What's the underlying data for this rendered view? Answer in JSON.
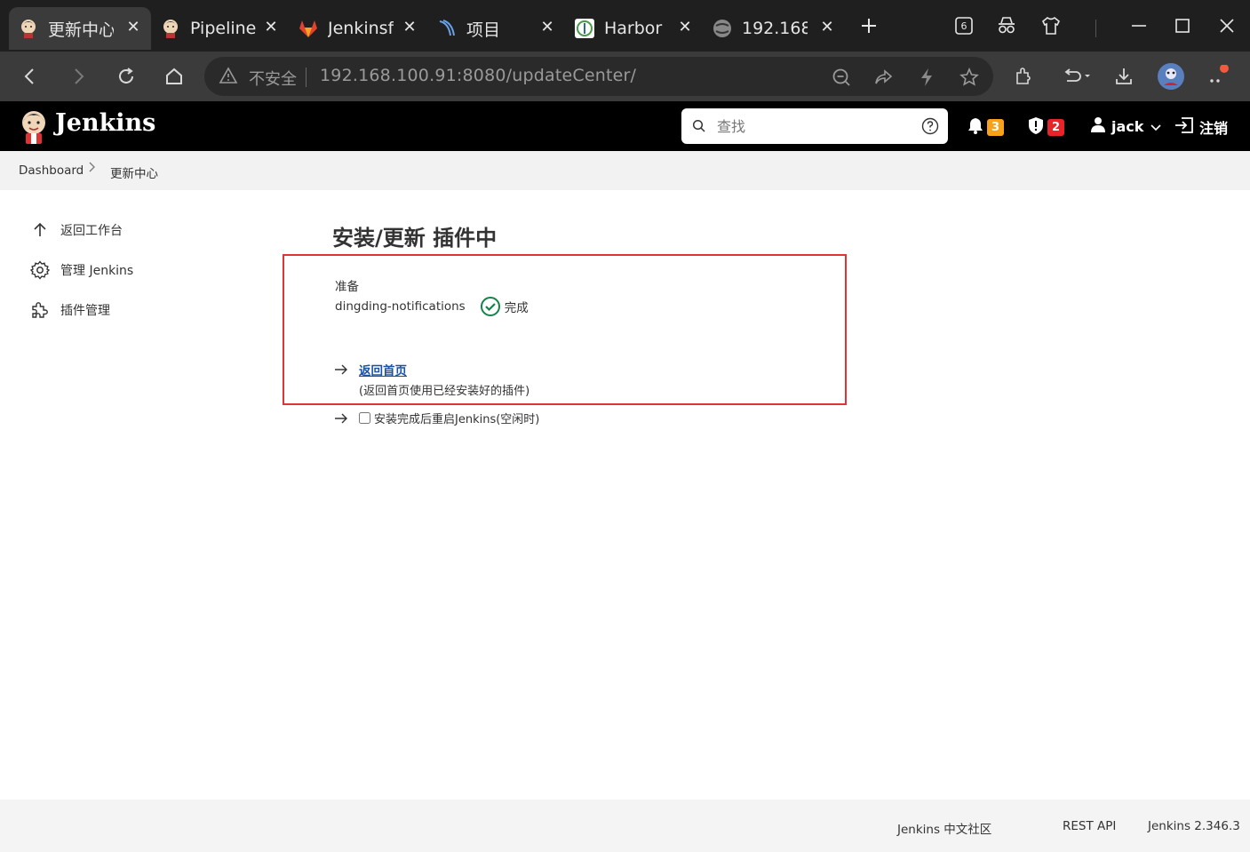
{
  "browser": {
    "tabs": [
      {
        "title": "更新中心",
        "icon": "jenkins-favicon-icon",
        "active": true
      },
      {
        "title": "Pipeline",
        "icon": "jenkins-favicon-icon",
        "active": false
      },
      {
        "title": "Jenkinsf",
        "icon": "gitlab-favicon-icon",
        "active": false
      },
      {
        "title": "项目",
        "icon": "project-favicon-icon",
        "active": false
      },
      {
        "title": "Harbor",
        "icon": "harbor-favicon-icon",
        "active": false
      },
      {
        "title": "192.168",
        "icon": "globe-favicon-icon",
        "active": false
      }
    ],
    "tab_count_badge": "6",
    "address": {
      "security_label": "不安全",
      "url": "192.168.100.91:8080/updateCenter/"
    }
  },
  "jenkins": {
    "brand": "Jenkins",
    "search_placeholder": "查找",
    "notifications_count": "3",
    "security_count": "2",
    "user": "jack",
    "logout": "注销",
    "breadcrumb": [
      "Dashboard",
      "更新中心"
    ],
    "sidebar": [
      {
        "label": "返回工作台",
        "icon": "arrow-up-icon"
      },
      {
        "label": "管理 Jenkins",
        "icon": "gear-icon"
      },
      {
        "label": "插件管理",
        "icon": "puzzle-icon"
      }
    ],
    "main": {
      "title": "安装/更新 插件中",
      "status_heading": "准备",
      "plugin_name": "dingding-notifications",
      "plugin_status": "完成",
      "go_home_link": "返回首页",
      "go_home_desc": "(返回首页使用已经安装好的插件)",
      "restart_label": "安装完成后重启Jenkins(空闲时)"
    },
    "footer": {
      "community": "Jenkins 中文社区",
      "rest_api": "REST API",
      "version": "Jenkins 2.346.3"
    }
  },
  "colors": {
    "accent_link": "#1a53a6",
    "highlight_box": "#e03535",
    "success": "#138347",
    "badge_warning": "#f7a21b",
    "badge_danger": "#e5252a"
  }
}
